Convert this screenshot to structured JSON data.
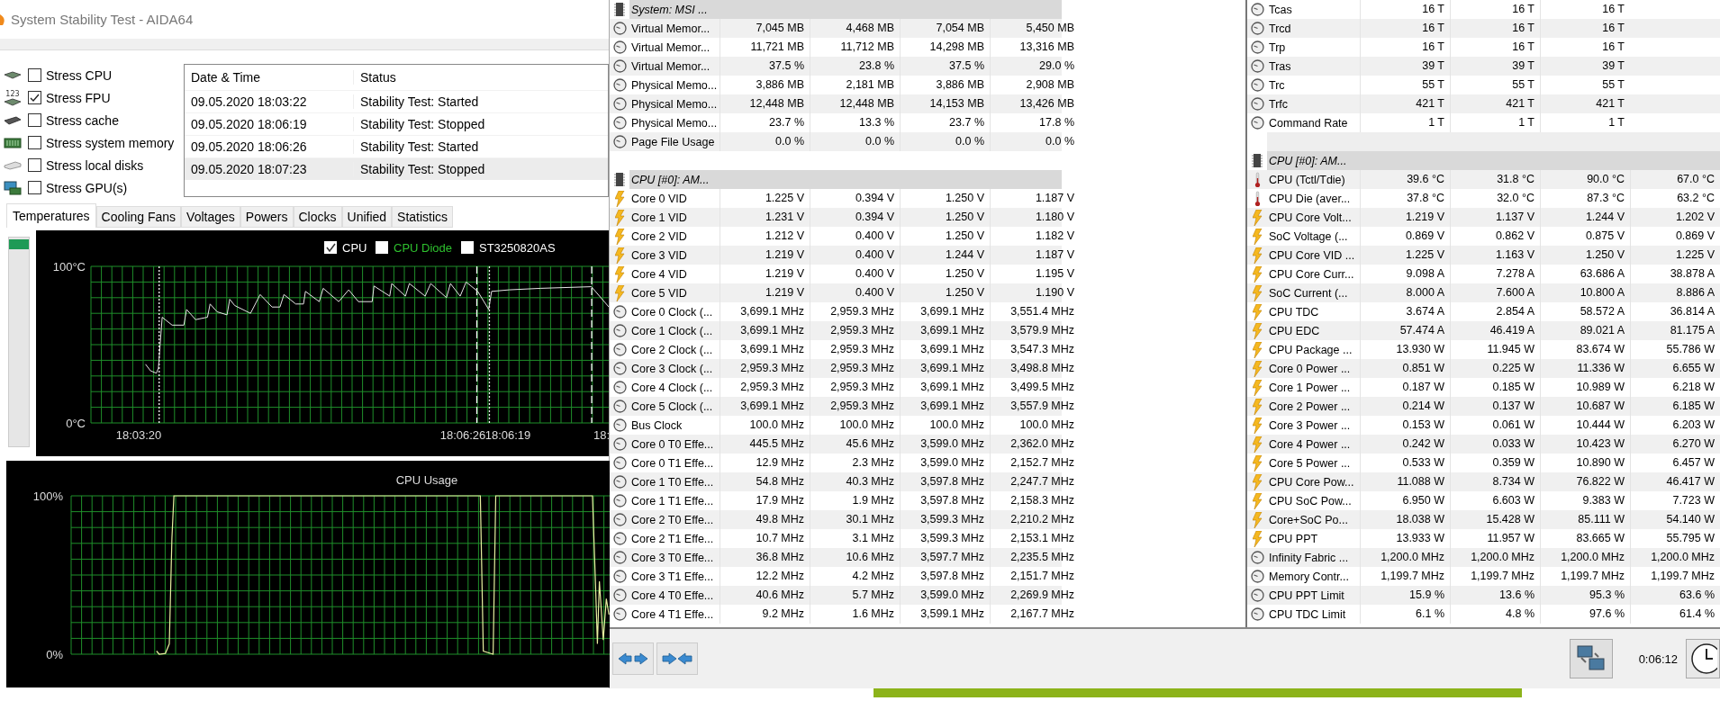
{
  "stability_window": {
    "title": "System Stability Test - AIDA64",
    "stress_options": [
      {
        "kind": "cpu",
        "label": "Stress CPU",
        "checked": false
      },
      {
        "kind": "fpu",
        "icon_caption": "123",
        "label": "Stress FPU",
        "checked": true
      },
      {
        "kind": "cache",
        "label": "Stress cache",
        "checked": false
      },
      {
        "kind": "memory",
        "label": "Stress system memory",
        "checked": false
      },
      {
        "kind": "disk",
        "label": "Stress local disks",
        "checked": false
      },
      {
        "kind": "gpu",
        "label": "Stress GPU(s)",
        "checked": false
      }
    ],
    "log": {
      "columns": [
        "Date & Time",
        "Status"
      ],
      "rows": [
        {
          "date_time": "09.05.2020 18:03:22",
          "status": "Stability Test: Started",
          "selected": false
        },
        {
          "date_time": "09.05.2020 18:06:19",
          "status": "Stability Test: Stopped",
          "selected": false
        },
        {
          "date_time": "09.05.2020 18:06:26",
          "status": "Stability Test: Started",
          "selected": false
        },
        {
          "date_time": "09.05.2020 18:07:23",
          "status": "Stability Test: Stopped",
          "selected": true
        }
      ]
    },
    "tabs": [
      {
        "label": "Temperatures",
        "selected": true
      },
      {
        "label": "Cooling Fans",
        "selected": false
      },
      {
        "label": "Voltages",
        "selected": false
      },
      {
        "label": "Powers",
        "selected": false
      },
      {
        "label": "Clocks",
        "selected": false
      },
      {
        "label": "Unified",
        "selected": false
      },
      {
        "label": "Statistics",
        "selected": false
      }
    ],
    "temperature_chart": {
      "legend": [
        {
          "label": "CPU",
          "checked": true,
          "color": "#ffffff"
        },
        {
          "label": "CPU Diode",
          "checked": false,
          "color": "#2ec02e"
        },
        {
          "label": "ST3250820AS",
          "checked": false,
          "color": "#ffffff"
        }
      ],
      "y_labels": [
        "100°C",
        "0°C"
      ],
      "x_labels": [
        "18:03:20",
        "18:06:26",
        "18:06:19",
        "18:"
      ]
    },
    "usage_chart": {
      "title": "CPU Usage",
      "y_labels": [
        "100%",
        "0%"
      ]
    }
  },
  "sensor_panels": [
    {
      "rows": [
        {
          "kind": "header",
          "label": "System: MSI ..."
        },
        {
          "kind": "clock",
          "label": "Virtual Memor...",
          "values": [
            "7,045 MB",
            "4,468 MB",
            "7,054 MB",
            "5,450 MB"
          ]
        },
        {
          "kind": "clock",
          "label": "Virtual Memor...",
          "values": [
            "11,721 MB",
            "11,712 MB",
            "14,298 MB",
            "13,316 MB"
          ]
        },
        {
          "kind": "clock",
          "label": "Virtual Memor...",
          "values": [
            "37.5 %",
            "23.8 %",
            "37.5 %",
            "29.0 %"
          ]
        },
        {
          "kind": "clock",
          "label": "Physical Memo...",
          "values": [
            "3,886 MB",
            "2,181 MB",
            "3,886 MB",
            "2,908 MB"
          ]
        },
        {
          "kind": "clock",
          "label": "Physical Memo...",
          "values": [
            "12,448 MB",
            "12,448 MB",
            "14,153 MB",
            "13,426 MB"
          ]
        },
        {
          "kind": "clock",
          "label": "Physical Memo...",
          "values": [
            "23.7 %",
            "13.3 %",
            "23.7 %",
            "17.8 %"
          ]
        },
        {
          "kind": "clock",
          "label": "Page File Usage",
          "values": [
            "0.0 %",
            "0.0 %",
            "0.0 %",
            "0.0 %"
          ]
        },
        {
          "kind": "spacer"
        },
        {
          "kind": "header",
          "label": "CPU [#0]: AM..."
        },
        {
          "kind": "bolt",
          "label": "Core 0 VID",
          "values": [
            "1.225 V",
            "0.394 V",
            "1.250 V",
            "1.187 V"
          ]
        },
        {
          "kind": "bolt",
          "label": "Core 1 VID",
          "values": [
            "1.231 V",
            "0.394 V",
            "1.250 V",
            "1.180 V"
          ]
        },
        {
          "kind": "bolt",
          "label": "Core 2 VID",
          "values": [
            "1.212 V",
            "0.400 V",
            "1.250 V",
            "1.182 V"
          ]
        },
        {
          "kind": "bolt",
          "label": "Core 3 VID",
          "values": [
            "1.219 V",
            "0.400 V",
            "1.244 V",
            "1.187 V"
          ]
        },
        {
          "kind": "bolt",
          "label": "Core 4 VID",
          "values": [
            "1.219 V",
            "0.400 V",
            "1.250 V",
            "1.195 V"
          ]
        },
        {
          "kind": "bolt",
          "label": "Core 5 VID",
          "values": [
            "1.219 V",
            "0.400 V",
            "1.250 V",
            "1.190 V"
          ]
        },
        {
          "kind": "clock",
          "label": "Core 0 Clock (...",
          "values": [
            "3,699.1 MHz",
            "2,959.3 MHz",
            "3,699.1 MHz",
            "3,551.4 MHz"
          ]
        },
        {
          "kind": "clock",
          "label": "Core 1 Clock (...",
          "values": [
            "3,699.1 MHz",
            "2,959.3 MHz",
            "3,699.1 MHz",
            "3,579.9 MHz"
          ]
        },
        {
          "kind": "clock",
          "label": "Core 2 Clock (...",
          "values": [
            "3,699.1 MHz",
            "2,959.3 MHz",
            "3,699.1 MHz",
            "3,547.3 MHz"
          ]
        },
        {
          "kind": "clock",
          "label": "Core 3 Clock (...",
          "values": [
            "2,959.3 MHz",
            "2,959.3 MHz",
            "3,699.1 MHz",
            "3,498.8 MHz"
          ]
        },
        {
          "kind": "clock",
          "label": "Core 4 Clock (...",
          "values": [
            "2,959.3 MHz",
            "2,959.3 MHz",
            "3,699.1 MHz",
            "3,499.5 MHz"
          ]
        },
        {
          "kind": "clock",
          "label": "Core 5 Clock (...",
          "values": [
            "3,699.1 MHz",
            "2,959.3 MHz",
            "3,699.1 MHz",
            "3,557.9 MHz"
          ]
        },
        {
          "kind": "clock",
          "label": "Bus Clock",
          "values": [
            "100.0 MHz",
            "100.0 MHz",
            "100.0 MHz",
            "100.0 MHz"
          ]
        },
        {
          "kind": "clock",
          "label": "Core 0 T0 Effe...",
          "values": [
            "445.5 MHz",
            "45.6 MHz",
            "3,599.0 MHz",
            "2,362.0 MHz"
          ]
        },
        {
          "kind": "clock",
          "label": "Core 0 T1 Effe...",
          "values": [
            "12.9 MHz",
            "2.3 MHz",
            "3,599.0 MHz",
            "2,152.7 MHz"
          ]
        },
        {
          "kind": "clock",
          "label": "Core 1 T0 Effe...",
          "values": [
            "54.8 MHz",
            "40.3 MHz",
            "3,597.8 MHz",
            "2,247.7 MHz"
          ]
        },
        {
          "kind": "clock",
          "label": "Core 1 T1 Effe...",
          "values": [
            "17.9 MHz",
            "1.9 MHz",
            "3,597.8 MHz",
            "2,158.3 MHz"
          ]
        },
        {
          "kind": "clock",
          "label": "Core 2 T0 Effe...",
          "values": [
            "49.8 MHz",
            "30.1 MHz",
            "3,599.3 MHz",
            "2,210.2 MHz"
          ]
        },
        {
          "kind": "clock",
          "label": "Core 2 T1 Effe...",
          "values": [
            "10.7 MHz",
            "3.1 MHz",
            "3,599.3 MHz",
            "2,153.1 MHz"
          ]
        },
        {
          "kind": "clock",
          "label": "Core 3 T0 Effe...",
          "values": [
            "36.8 MHz",
            "10.6 MHz",
            "3,597.7 MHz",
            "2,235.5 MHz"
          ]
        },
        {
          "kind": "clock",
          "label": "Core 3 T1 Effe...",
          "values": [
            "12.2 MHz",
            "4.2 MHz",
            "3,597.8 MHz",
            "2,151.7 MHz"
          ]
        },
        {
          "kind": "clock",
          "label": "Core 4 T0 Effe...",
          "values": [
            "40.6 MHz",
            "5.7 MHz",
            "3,599.0 MHz",
            "2,269.9 MHz"
          ]
        },
        {
          "kind": "clock",
          "label": "Core 4 T1 Effe...",
          "values": [
            "9.2 MHz",
            "1.6 MHz",
            "3,599.1 MHz",
            "2,167.7 MHz"
          ]
        }
      ]
    },
    {
      "rows": [
        {
          "kind": "clock",
          "label": "Tcas",
          "values": [
            "16 T",
            "16 T",
            "16 T"
          ]
        },
        {
          "kind": "clock",
          "label": "Trcd",
          "values": [
            "16 T",
            "16 T",
            "16 T"
          ]
        },
        {
          "kind": "clock",
          "label": "Trp",
          "values": [
            "16 T",
            "16 T",
            "16 T"
          ]
        },
        {
          "kind": "clock",
          "label": "Tras",
          "values": [
            "39 T",
            "39 T",
            "39 T"
          ]
        },
        {
          "kind": "clock",
          "label": "Trc",
          "values": [
            "55 T",
            "55 T",
            "55 T"
          ]
        },
        {
          "kind": "clock",
          "label": "Trfc",
          "values": [
            "421 T",
            "421 T",
            "421 T"
          ]
        },
        {
          "kind": "clock",
          "label": "Command Rate",
          "values": [
            "1 T",
            "1 T",
            "1 T"
          ]
        },
        {
          "kind": "spacer"
        },
        {
          "kind": "header",
          "label": "CPU [#0]: AM..."
        },
        {
          "kind": "thermometer",
          "label": "CPU (Tctl/Tdie)",
          "values": [
            "39.6 °C",
            "31.8 °C",
            "90.0 °C",
            "67.0 °C"
          ]
        },
        {
          "kind": "thermometer",
          "label": "CPU Die (aver...",
          "values": [
            "37.8 °C",
            "32.0 °C",
            "87.3 °C",
            "63.2 °C"
          ]
        },
        {
          "kind": "bolt",
          "label": "CPU Core Volt...",
          "values": [
            "1.219 V",
            "1.137 V",
            "1.244 V",
            "1.202 V"
          ]
        },
        {
          "kind": "bolt",
          "label": "SoC Voltage (...",
          "values": [
            "0.869 V",
            "0.862 V",
            "0.875 V",
            "0.869 V"
          ]
        },
        {
          "kind": "bolt",
          "label": "CPU Core VID ...",
          "values": [
            "1.225 V",
            "1.163 V",
            "1.250 V",
            "1.225 V"
          ]
        },
        {
          "kind": "bolt",
          "label": "CPU Core Curr...",
          "values": [
            "9.098 A",
            "7.278 A",
            "63.686 A",
            "38.878 A"
          ]
        },
        {
          "kind": "bolt",
          "label": "SoC Current (...",
          "values": [
            "8.000 A",
            "7.600 A",
            "10.800 A",
            "8.886 A"
          ]
        },
        {
          "kind": "bolt",
          "label": "CPU TDC",
          "values": [
            "3.674 A",
            "2.854 A",
            "58.572 A",
            "36.814 A"
          ]
        },
        {
          "kind": "bolt",
          "label": "CPU EDC",
          "values": [
            "57.474 A",
            "46.419 A",
            "89.021 A",
            "81.175 A"
          ]
        },
        {
          "kind": "bolt",
          "label": "CPU Package ...",
          "values": [
            "13.930 W",
            "11.945 W",
            "83.674 W",
            "55.786 W"
          ]
        },
        {
          "kind": "bolt",
          "label": "Core 0 Power ...",
          "values": [
            "0.851 W",
            "0.225 W",
            "11.336 W",
            "6.655 W"
          ]
        },
        {
          "kind": "bolt",
          "label": "Core 1 Power ...",
          "values": [
            "0.187 W",
            "0.185 W",
            "10.989 W",
            "6.218 W"
          ]
        },
        {
          "kind": "bolt",
          "label": "Core 2 Power ...",
          "values": [
            "0.214 W",
            "0.137 W",
            "10.687 W",
            "6.185 W"
          ]
        },
        {
          "kind": "bolt",
          "label": "Core 3 Power ...",
          "values": [
            "0.153 W",
            "0.061 W",
            "10.444 W",
            "6.203 W"
          ]
        },
        {
          "kind": "bolt",
          "label": "Core 4 Power ...",
          "values": [
            "0.242 W",
            "0.033 W",
            "10.423 W",
            "6.270 W"
          ]
        },
        {
          "kind": "bolt",
          "label": "Core 5 Power ...",
          "values": [
            "0.533 W",
            "0.359 W",
            "10.890 W",
            "6.457 W"
          ]
        },
        {
          "kind": "bolt",
          "label": "CPU Core Pow...",
          "values": [
            "11.088 W",
            "8.734 W",
            "76.822 W",
            "46.417 W"
          ]
        },
        {
          "kind": "bolt",
          "label": "CPU SoC Pow...",
          "values": [
            "6.950 W",
            "6.603 W",
            "9.383 W",
            "7.723 W"
          ]
        },
        {
          "kind": "bolt",
          "label": "Core+SoC Po...",
          "values": [
            "18.038 W",
            "15.428 W",
            "85.111 W",
            "54.140 W"
          ]
        },
        {
          "kind": "bolt",
          "label": "CPU PPT",
          "values": [
            "13.933 W",
            "11.957 W",
            "83.665 W",
            "55.795 W"
          ]
        },
        {
          "kind": "clock",
          "label": "Infinity Fabric ...",
          "values": [
            "1,200.0 MHz",
            "1,200.0 MHz",
            "1,200.0 MHz",
            "1,200.0 MHz"
          ]
        },
        {
          "kind": "clock",
          "label": "Memory Contr...",
          "values": [
            "1,199.7 MHz",
            "1,199.7 MHz",
            "1,199.7 MHz",
            "1,199.7 MHz"
          ]
        },
        {
          "kind": "clock",
          "label": "CPU PPT Limit",
          "values": [
            "15.9 %",
            "13.6 %",
            "95.3 %",
            "63.6 %"
          ]
        },
        {
          "kind": "clock",
          "label": "CPU TDC Limit",
          "values": [
            "6.1 %",
            "4.8 %",
            "97.6 %",
            "61.4 %"
          ]
        }
      ]
    }
  ],
  "footer": {
    "elapsed": "0:06:12"
  }
}
